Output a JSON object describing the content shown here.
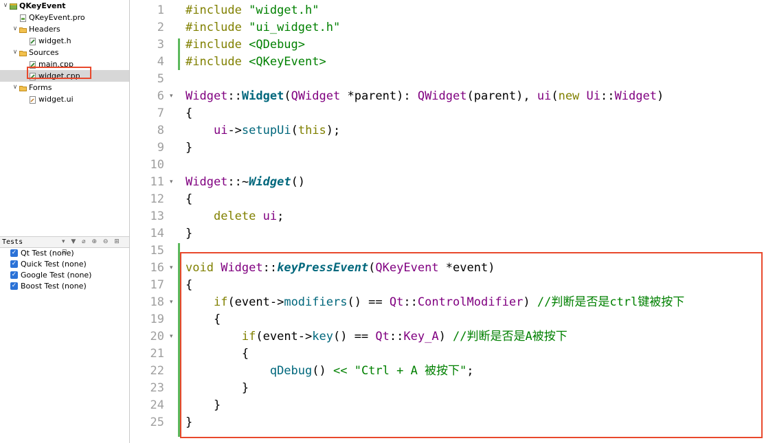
{
  "project_tree": {
    "items": [
      {
        "label": "QKeyEvent",
        "depth": 0,
        "arrow": "∨",
        "icon": "project-icon",
        "bold": true
      },
      {
        "label": "QKeyEvent.pro",
        "depth": 1,
        "arrow": "",
        "icon": "pro-file-icon"
      },
      {
        "label": "Headers",
        "depth": 1,
        "arrow": "∨",
        "icon": "folder-icon"
      },
      {
        "label": "widget.h",
        "depth": 2,
        "arrow": "",
        "icon": "header-file-icon"
      },
      {
        "label": "Sources",
        "depth": 1,
        "arrow": "∨",
        "icon": "folder-icon"
      },
      {
        "label": "main.cpp",
        "depth": 2,
        "arrow": "",
        "icon": "cpp-file-icon"
      },
      {
        "label": "widget.cpp",
        "depth": 2,
        "arrow": "",
        "icon": "cpp-file-icon",
        "selected": true
      },
      {
        "label": "Forms",
        "depth": 1,
        "arrow": "∨",
        "icon": "folder-icon"
      },
      {
        "label": "widget.ui",
        "depth": 2,
        "arrow": "",
        "icon": "ui-file-icon"
      }
    ]
  },
  "tests_panel": {
    "title": "Tests",
    "tools": "▾ ▼ ⌀ ⊕ ⊖ ⊞ ⊟",
    "items": [
      {
        "label": "Qt Test (none)",
        "checked": true
      },
      {
        "label": "Quick Test (none)",
        "checked": true
      },
      {
        "label": "Google Test (none)",
        "checked": true
      },
      {
        "label": "Boost Test (none)",
        "checked": true
      }
    ]
  },
  "editor": {
    "lines": [
      {
        "n": "1",
        "fold": "",
        "tokens": [
          [
            "#include ",
            "k"
          ],
          [
            "\"widget.h\"",
            "s"
          ]
        ]
      },
      {
        "n": "2",
        "fold": "",
        "tokens": [
          [
            "#include ",
            "k"
          ],
          [
            "\"ui_widget.h\"",
            "s"
          ]
        ]
      },
      {
        "n": "3",
        "fold": "",
        "tokens": [
          [
            "#include ",
            "k"
          ],
          [
            "<QDebug>",
            "s"
          ]
        ]
      },
      {
        "n": "4",
        "fold": "",
        "tokens": [
          [
            "#include ",
            "k"
          ],
          [
            "<QKeyEvent>",
            "s"
          ]
        ]
      },
      {
        "n": "5",
        "fold": "",
        "tokens": []
      },
      {
        "n": "6",
        "fold": "▾",
        "tokens": [
          [
            "Widget",
            "t"
          ],
          [
            "::",
            ""
          ],
          [
            "Widget",
            "fn"
          ],
          [
            "(",
            ""
          ],
          [
            "QWidget",
            "t"
          ],
          [
            " *parent): ",
            ""
          ],
          [
            "QWidget",
            "t"
          ],
          [
            "(parent), ",
            ""
          ],
          [
            "ui",
            "t"
          ],
          [
            "(",
            ""
          ],
          [
            "new",
            "k"
          ],
          [
            " ",
            ""
          ],
          [
            "Ui",
            "t"
          ],
          [
            "::",
            ""
          ],
          [
            "Widget",
            "t"
          ],
          [
            ")",
            ""
          ]
        ]
      },
      {
        "n": "7",
        "fold": "",
        "tokens": [
          [
            "{",
            ""
          ]
        ]
      },
      {
        "n": "8",
        "fold": "",
        "tokens": [
          [
            "    ",
            ""
          ],
          [
            "ui",
            "t"
          ],
          [
            "->",
            ""
          ],
          [
            "setupUi",
            "m"
          ],
          [
            "(",
            ""
          ],
          [
            "this",
            "k"
          ],
          [
            ");",
            ""
          ]
        ]
      },
      {
        "n": "9",
        "fold": "",
        "tokens": [
          [
            "}",
            ""
          ]
        ]
      },
      {
        "n": "10",
        "fold": "",
        "tokens": []
      },
      {
        "n": "11",
        "fold": "▾",
        "tokens": [
          [
            "Widget",
            "t"
          ],
          [
            "::~",
            ""
          ],
          [
            "Widget",
            "fni"
          ],
          [
            "()",
            ""
          ]
        ]
      },
      {
        "n": "12",
        "fold": "",
        "tokens": [
          [
            "{",
            ""
          ]
        ]
      },
      {
        "n": "13",
        "fold": "",
        "tokens": [
          [
            "    ",
            ""
          ],
          [
            "delete",
            "k"
          ],
          [
            " ",
            ""
          ],
          [
            "ui",
            "t"
          ],
          [
            ";",
            ""
          ]
        ]
      },
      {
        "n": "14",
        "fold": "",
        "tokens": [
          [
            "}",
            ""
          ]
        ]
      },
      {
        "n": "15",
        "fold": "",
        "tokens": []
      },
      {
        "n": "16",
        "fold": "▾",
        "tokens": [
          [
            "void",
            "k"
          ],
          [
            " ",
            ""
          ],
          [
            "Widget",
            "t"
          ],
          [
            "::",
            ""
          ],
          [
            "keyPressEvent",
            "fni"
          ],
          [
            "(",
            ""
          ],
          [
            "QKeyEvent",
            "t"
          ],
          [
            " *event)",
            ""
          ]
        ]
      },
      {
        "n": "17",
        "fold": "",
        "tokens": [
          [
            "{",
            ""
          ]
        ]
      },
      {
        "n": "18",
        "fold": "▾",
        "tokens": [
          [
            "    ",
            ""
          ],
          [
            "if",
            "k"
          ],
          [
            "(event->",
            ""
          ],
          [
            "modifiers",
            "m"
          ],
          [
            "() == ",
            ""
          ],
          [
            "Qt",
            "t"
          ],
          [
            "::",
            ""
          ],
          [
            "ControlModifier",
            "t"
          ],
          [
            ") ",
            ""
          ],
          [
            "//判断是否是ctrl键被按下",
            "c"
          ]
        ]
      },
      {
        "n": "19",
        "fold": "",
        "tokens": [
          [
            "    {",
            ""
          ]
        ]
      },
      {
        "n": "20",
        "fold": "▾",
        "tokens": [
          [
            "        ",
            ""
          ],
          [
            "if",
            "k"
          ],
          [
            "(event->",
            ""
          ],
          [
            "key",
            "m"
          ],
          [
            "() == ",
            ""
          ],
          [
            "Qt",
            "t"
          ],
          [
            "::",
            ""
          ],
          [
            "Key_A",
            "t"
          ],
          [
            ") ",
            ""
          ],
          [
            "//判断是否是A被按下",
            "c"
          ]
        ]
      },
      {
        "n": "21",
        "fold": "",
        "tokens": [
          [
            "        {",
            ""
          ]
        ]
      },
      {
        "n": "22",
        "fold": "",
        "tokens": [
          [
            "            ",
            ""
          ],
          [
            "qDebug",
            "m"
          ],
          [
            "() ",
            ""
          ],
          [
            "<<",
            "s"
          ],
          [
            " ",
            ""
          ],
          [
            "\"Ctrl + A 被按下\"",
            "s"
          ],
          [
            ";",
            ""
          ]
        ]
      },
      {
        "n": "23",
        "fold": "",
        "tokens": [
          [
            "        }",
            ""
          ]
        ]
      },
      {
        "n": "24",
        "fold": "",
        "tokens": [
          [
            "    }",
            ""
          ]
        ]
      },
      {
        "n": "25",
        "fold": "",
        "tokens": [
          [
            "}",
            ""
          ]
        ]
      }
    ]
  },
  "colors": {
    "highlight_box": "#e8482c",
    "change_bar": "#5cb85c",
    "keyword": "#808000",
    "type": "#800080",
    "method": "#00677c",
    "string": "#008000"
  }
}
